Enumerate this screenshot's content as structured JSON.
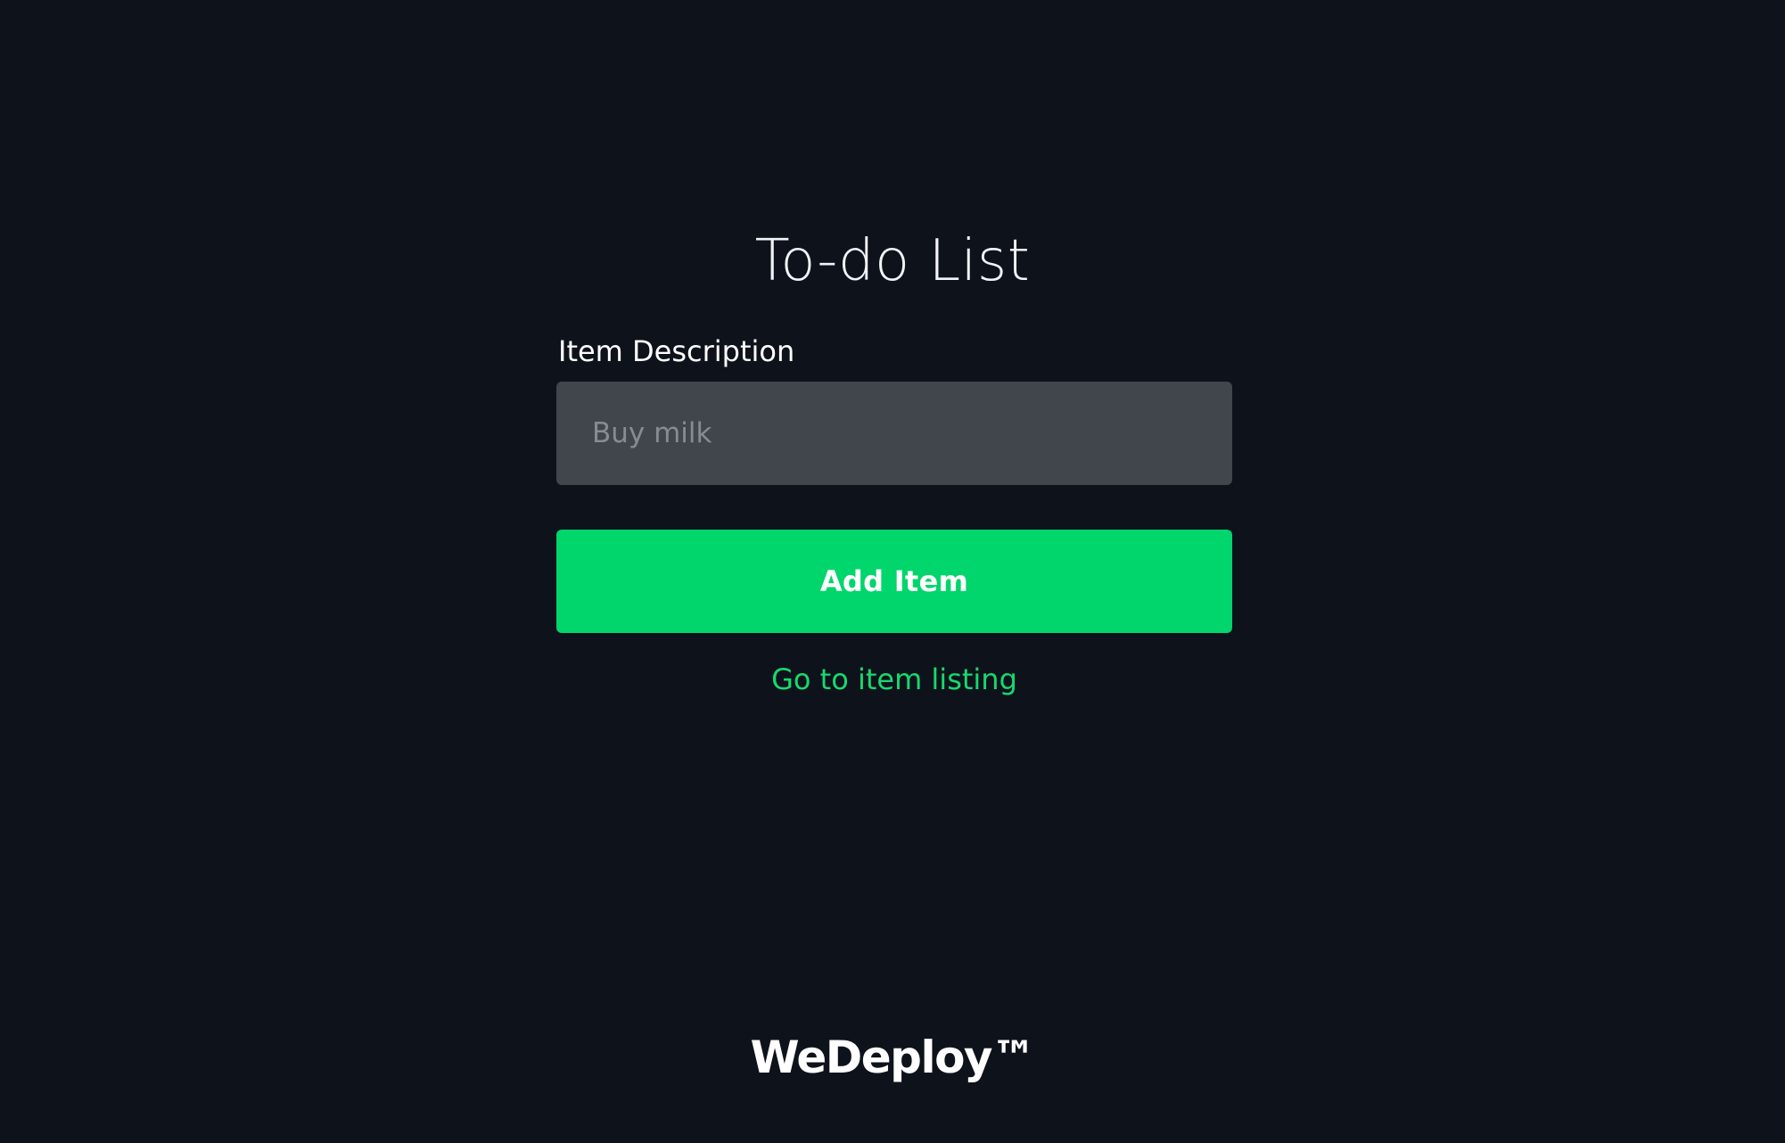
{
  "header": {
    "title": "To-do List"
  },
  "form": {
    "item_label": "Item Description",
    "item_input": {
      "value": "",
      "placeholder": "Buy milk"
    },
    "add_button_label": "Add Item",
    "listing_link_label": "Go to item listing"
  },
  "footer": {
    "brand": "WeDeploy™"
  },
  "colors": {
    "background": "#0e131b",
    "input_background": "#40464b",
    "accent": "#00d66b",
    "link": "#18d86f",
    "text": "#ffffff",
    "placeholder": "#868c91"
  }
}
